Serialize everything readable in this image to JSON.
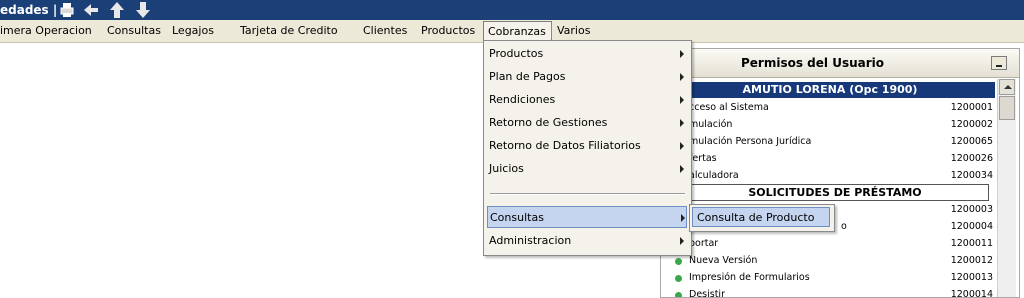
{
  "topbar": {
    "title": "edades |",
    "icons": [
      "printer-icon",
      "back-arrow-icon",
      "up-arrow-icon",
      "down-arrow-icon"
    ]
  },
  "menu": {
    "items": [
      {
        "label": "imera Operacion"
      },
      {
        "label": "Consultas"
      },
      {
        "label": "Legajos"
      },
      {
        "label": "Tarjeta de Credito"
      },
      {
        "label": "Clientes"
      },
      {
        "label": "Productos"
      },
      {
        "label": "Cobranzas"
      },
      {
        "label": "Varios"
      }
    ]
  },
  "dropdown": {
    "items": [
      {
        "label": "Productos"
      },
      {
        "label": "Plan de Pagos"
      },
      {
        "label": "Rendiciones"
      },
      {
        "label": "Retorno de Gestiones"
      },
      {
        "label": "Retorno de Datos Filiatorios"
      },
      {
        "label": "Juicios"
      },
      {
        "label": "Consultas"
      },
      {
        "label": "Administracion"
      }
    ],
    "submenu": {
      "label": "Consulta de Producto"
    }
  },
  "panel": {
    "title": "Permisos del Usuario",
    "user": "AMUTIO LORENA (Opc 1900)",
    "rows_top": [
      {
        "label": "cceso al Sistema",
        "code": "1200001"
      },
      {
        "label": "mulación",
        "code": "1200002"
      },
      {
        "label": "mulación Persona Jurídica",
        "code": "1200065"
      },
      {
        "label": "fertas",
        "code": "1200026"
      },
      {
        "label": "alculadora",
        "code": "1200034"
      }
    ],
    "section": "SOLICITUDES DE PRÉSTAMO",
    "rows_bottom": [
      {
        "label": "",
        "code": "1200003"
      },
      {
        "label": "o",
        "code": "1200004"
      },
      {
        "label": "portar",
        "code": "1200011"
      },
      {
        "label": "Nueva Versión",
        "code": "1200012"
      },
      {
        "label": "Impresión de Formularios",
        "code": "1200013"
      },
      {
        "label": "Desistir",
        "code": "1200014"
      }
    ]
  },
  "colors": {
    "topbar": "#1b3f77",
    "menubar": "#ece9d8",
    "user_bar": "#17397a",
    "highlight": "#c5d4ef",
    "status_dot": "#3aa84a"
  }
}
